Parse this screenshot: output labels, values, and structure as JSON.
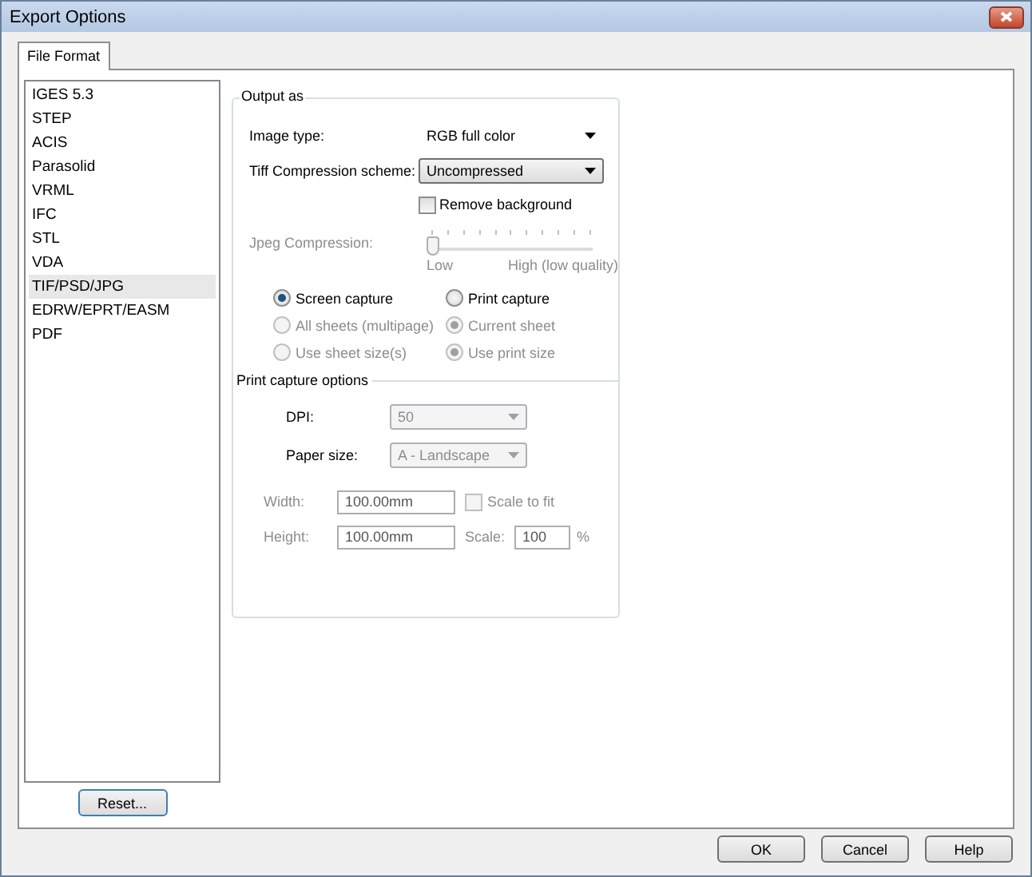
{
  "window": {
    "title": "Export Options"
  },
  "tabs": [
    {
      "label": "File Format",
      "selected": true
    }
  ],
  "formats": [
    {
      "label": "IGES 5.3",
      "selected": false
    },
    {
      "label": "STEP",
      "selected": false
    },
    {
      "label": "ACIS",
      "selected": false
    },
    {
      "label": "Parasolid",
      "selected": false
    },
    {
      "label": "VRML",
      "selected": false
    },
    {
      "label": "IFC",
      "selected": false
    },
    {
      "label": "STL",
      "selected": false
    },
    {
      "label": "VDA",
      "selected": false
    },
    {
      "label": "TIF/PSD/JPG",
      "selected": true
    },
    {
      "label": "EDRW/EPRT/EASM",
      "selected": false
    },
    {
      "label": "PDF",
      "selected": false
    }
  ],
  "reset_button": "Reset...",
  "output_as": {
    "title": "Output as",
    "image_type": {
      "label": "Image type:",
      "value": "RGB full color"
    },
    "tiff_compression": {
      "label": "Tiff Compression scheme:",
      "value": "Uncompressed"
    },
    "remove_background": {
      "label": "Remove background",
      "checked": false
    },
    "jpeg_compression": {
      "label": "Jpeg Compression:",
      "disabled": true,
      "level": 0,
      "low_label": "Low",
      "high_label": "High (low quality)"
    },
    "radios": [
      {
        "label": "Screen capture",
        "selected": true,
        "disabled": false
      },
      {
        "label": "Print capture",
        "selected": false,
        "disabled": false
      },
      {
        "label": "All sheets (multipage)",
        "selected": false,
        "disabled": true
      },
      {
        "label": "Current sheet",
        "selected": true,
        "disabled": true
      },
      {
        "label": "Use sheet size(s)",
        "selected": false,
        "disabled": true
      },
      {
        "label": "Use print size",
        "selected": true,
        "disabled": true
      }
    ]
  },
  "print_capture_options": {
    "title": "Print capture options",
    "dpi": {
      "label": "DPI:",
      "value": "50",
      "disabled": true
    },
    "paper_size": {
      "label": "Paper size:",
      "value": "A - Landscape",
      "disabled": true
    },
    "width": {
      "label": "Width:",
      "value": "100.00mm",
      "disabled": true
    },
    "scale_to_fit": {
      "label": "Scale to fit",
      "checked": false,
      "disabled": true
    },
    "height": {
      "label": "Height:",
      "value": "100.00mm",
      "disabled": true
    },
    "scale": {
      "label": "Scale:",
      "value": "100",
      "unit": "%",
      "disabled": true
    }
  },
  "buttons": [
    "OK",
    "Cancel",
    "Help"
  ]
}
